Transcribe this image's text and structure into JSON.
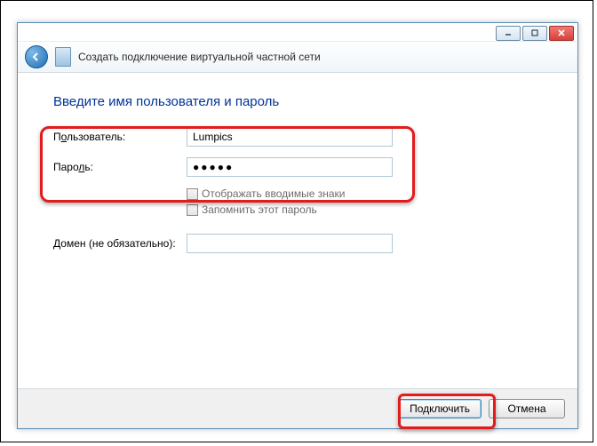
{
  "window": {
    "wizard_title": "Создать подключение виртуальной частной сети"
  },
  "content": {
    "heading": "Введите имя пользователя и пароль",
    "user_label_pre": "П",
    "user_label_ul": "о",
    "user_label_post": "льзователь:",
    "user_value": "Lumpics",
    "pass_label_pre": "Паро",
    "pass_label_ul": "л",
    "pass_label_post": "ь:",
    "pass_value": "●●●●●",
    "show_chars_label": "Отображать вводимые знаки",
    "remember_label": "Запомнить этот пароль",
    "domain_label_pre": "",
    "domain_label_ul": "Д",
    "domain_label_post": "омен (не обязательно):",
    "domain_value": ""
  },
  "footer": {
    "connect": "Подключить",
    "cancel": "Отмена"
  }
}
